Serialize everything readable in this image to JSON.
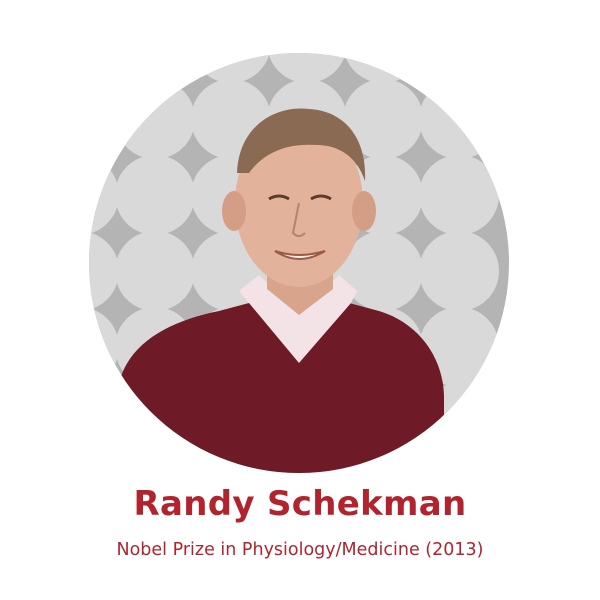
{
  "profile": {
    "name": "Randy Schekman",
    "award": "Nobel Prize in Physiology/Medicine (2013)"
  },
  "photo": {
    "background_pattern_color": "#d9d9d9",
    "background_star_color": "#b4b4b4",
    "sweater_color": "#6e1a27",
    "shirt_color": "#f3e2e6"
  },
  "colors": {
    "accent": "#b1242e",
    "page_background": "#ffffff"
  }
}
